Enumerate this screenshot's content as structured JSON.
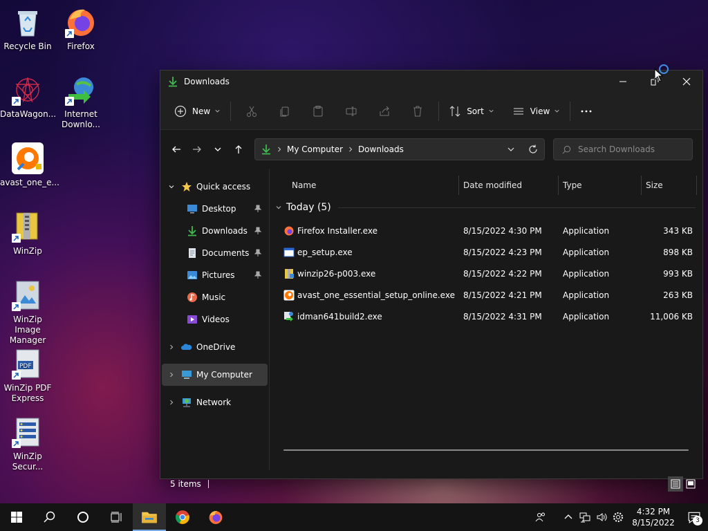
{
  "desktop": {
    "icons": [
      {
        "label": "Recycle Bin"
      },
      {
        "label": "Firefox"
      },
      {
        "label": "DataWagon..."
      },
      {
        "label": "Internet Downlo..."
      },
      {
        "label": "avast_one_e..."
      },
      {
        "label": "WinZip"
      },
      {
        "label": "WinZip Image Manager"
      },
      {
        "label": "WinZip PDF Express"
      },
      {
        "label": "WinZip Secur..."
      }
    ]
  },
  "window": {
    "title": "Downloads",
    "icon": "download-arrow-icon"
  },
  "toolbar": {
    "new_label": "New",
    "sort_label": "Sort",
    "view_label": "View"
  },
  "address": {
    "crumbs": [
      "My Computer",
      "Downloads"
    ]
  },
  "search": {
    "placeholder": "Search Downloads"
  },
  "sidebar": {
    "quick_access": "Quick access",
    "items": [
      {
        "label": "Desktop"
      },
      {
        "label": "Downloads"
      },
      {
        "label": "Documents"
      },
      {
        "label": "Pictures"
      },
      {
        "label": "Music"
      },
      {
        "label": "Videos"
      }
    ],
    "onedrive": "OneDrive",
    "my_computer": "My Computer",
    "network": "Network"
  },
  "columns": {
    "name": "Name",
    "date": "Date modified",
    "type": "Type",
    "size": "Size"
  },
  "group": {
    "label": "Today (5)"
  },
  "files": [
    {
      "name": "Firefox Installer.exe",
      "date": "8/15/2022 4:30 PM",
      "type": "Application",
      "size": "343 KB"
    },
    {
      "name": "ep_setup.exe",
      "date": "8/15/2022 4:23 PM",
      "type": "Application",
      "size": "898 KB"
    },
    {
      "name": "winzip26-p003.exe",
      "date": "8/15/2022 4:22 PM",
      "type": "Application",
      "size": "993 KB"
    },
    {
      "name": "avast_one_essential_setup_online.exe",
      "date": "8/15/2022 4:21 PM",
      "type": "Application",
      "size": "263 KB"
    },
    {
      "name": "idman641build2.exe",
      "date": "8/15/2022 4:31 PM",
      "type": "Application",
      "size": "11,006 KB"
    }
  ],
  "status": {
    "items": "5 items"
  },
  "taskbar": {
    "time": "4:32 PM",
    "date": "8/15/2022",
    "notifications": "3"
  },
  "colors": {
    "accent_download": "#3fb950",
    "folder_yellow": "#f3c74b",
    "taskbar_active": "#7aa9e8"
  }
}
